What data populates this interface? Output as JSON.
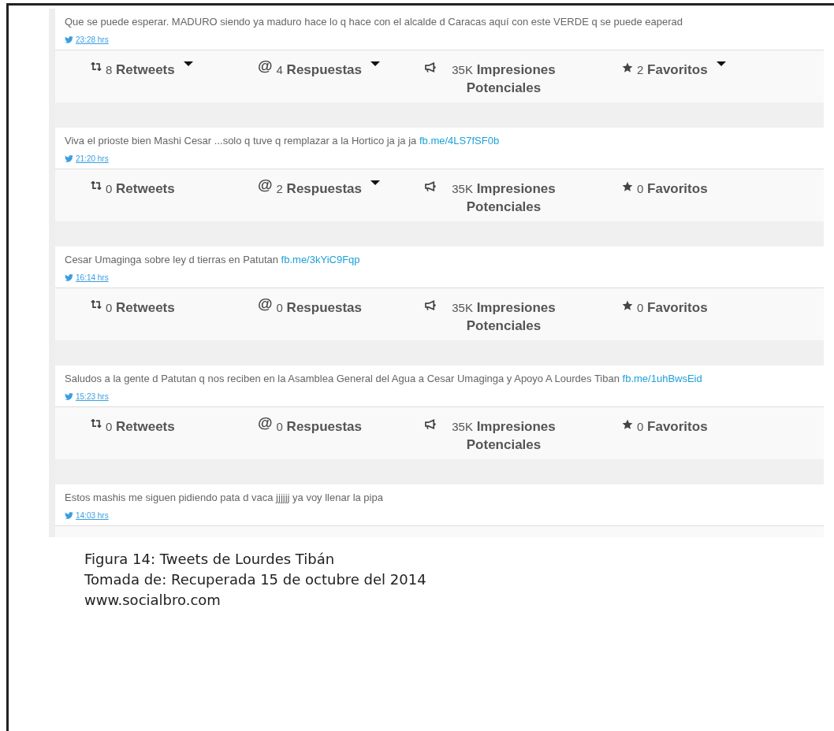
{
  "tweets": [
    {
      "text": "Que se puede esperar. MADURO siendo ya maduro hace lo q hace con el alcalde d Caracas aquí con este VERDE q se puede eaperad",
      "time": "23:28 hrs",
      "stats": [
        {
          "kind": "retweets",
          "count": "8",
          "label": "Retweets",
          "dropdown": true
        },
        {
          "kind": "replies",
          "icon": "@",
          "count": "4",
          "label": "Respuestas",
          "dropdown": true
        },
        {
          "kind": "impressions",
          "count": "35K",
          "label": "Impresiones Potenciales",
          "dropdown": false
        },
        {
          "kind": "favorites",
          "count": "2",
          "label": "Favoritos",
          "dropdown": true
        }
      ]
    },
    {
      "text": "Viva el prioste bien Mashi Cesar ...solo q tuve q remplazar a la Hortico ja ja ja",
      "link": "fb.me/4LS7fSF0b",
      "time": "21:20 hrs",
      "stats": [
        {
          "kind": "retweets",
          "count": "0",
          "label": "Retweets",
          "dropdown": false
        },
        {
          "kind": "replies",
          "icon": "@",
          "count": "2",
          "label": "Respuestas",
          "dropdown": true
        },
        {
          "kind": "impressions",
          "count": "35K",
          "label": "Impresiones Potenciales",
          "dropdown": false
        },
        {
          "kind": "favorites",
          "count": "0",
          "label": "Favoritos",
          "dropdown": false
        }
      ]
    },
    {
      "text": "Cesar Umaginga sobre ley d tierras en Patutan",
      "link": "fb.me/3kYiC9Fqp",
      "time": "16:14 hrs",
      "stats": [
        {
          "kind": "retweets",
          "count": "0",
          "label": "Retweets",
          "dropdown": false
        },
        {
          "kind": "replies",
          "icon": "@",
          "count": "0",
          "label": "Respuestas",
          "dropdown": false
        },
        {
          "kind": "impressions",
          "count": "35K",
          "label": "Impresiones Potenciales",
          "dropdown": false
        },
        {
          "kind": "favorites",
          "count": "0",
          "label": "Favoritos",
          "dropdown": false
        }
      ]
    },
    {
      "text": "Saludos a la gente d Patutan q nos reciben en la Asamblea General del Agua a Cesar Umaginga y Apoyo A Lourdes Tiban",
      "link": "fb.me/1uhBwsEid",
      "time": "15:23 hrs",
      "stats": [
        {
          "kind": "retweets",
          "count": "0",
          "label": "Retweets",
          "dropdown": false
        },
        {
          "kind": "replies",
          "icon": "@",
          "count": "0",
          "label": "Respuestas",
          "dropdown": false
        },
        {
          "kind": "impressions",
          "count": "35K",
          "label": "Impresiones Potenciales",
          "dropdown": false
        },
        {
          "kind": "favorites",
          "count": "0",
          "label": "Favoritos",
          "dropdown": false
        }
      ]
    },
    {
      "text": "Estos mashis me siguen pidiendo pata d vaca jjjjjj ya voy llenar la pipa",
      "time": "14:03 hrs"
    }
  ],
  "caption": [
    "Figura 14: Tweets de Lourdes Tibán",
    "Tomada de: Recuperada 15 de octubre del 2014",
    "www.socialbro.com"
  ]
}
